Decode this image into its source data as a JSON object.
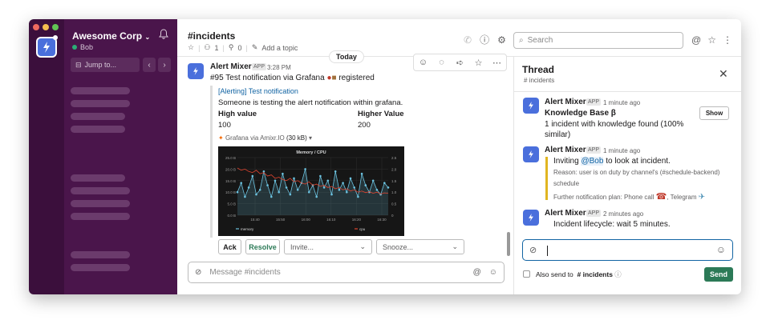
{
  "workspace": {
    "name": "Awesome Corp",
    "user": "Bob",
    "jump_label": "Jump to..."
  },
  "channel": {
    "title": "#incidents",
    "members": "1",
    "pins": "0",
    "add_topic": "Add a topic"
  },
  "search": {
    "placeholder": "Search"
  },
  "divider": {
    "label": "Today"
  },
  "message": {
    "sender": "Alert Mixer",
    "badge": "APP",
    "time": "3:28 PM",
    "text": "#95 Test notification via Grafana",
    "suffix": "registered",
    "alert_title": "[Alerting] Test notification",
    "alert_desc": "Someone is testing the alert notification within grafana.",
    "high_label": "High value",
    "high_value": "100",
    "higher_label": "Higher Value",
    "higher_value": "200",
    "file_label": "Grafana via Amixr.IO",
    "file_size": "(30 kB)",
    "buttons": {
      "ack": "Ack",
      "resolve": "Resolve",
      "invite": "Invite...",
      "snooze": "Snooze..."
    }
  },
  "composer": {
    "placeholder": "Message #incidents"
  },
  "thread": {
    "title": "Thread",
    "channel": "# incidents",
    "show_label": "Show",
    "messages": [
      {
        "sender": "Alert Mixer",
        "badge": "APP",
        "time": "1 minute ago",
        "line1": "Knowledge Base β",
        "line2": "1 incident with knowledge found (100%",
        "line3": "similar)"
      },
      {
        "sender": "Alert Mixer",
        "badge": "APP",
        "time": "1 minute ago",
        "invite_prefix": "Inviting",
        "invite_user": "@Bob",
        "invite_suffix": "to look at incident.",
        "reason": "Reason: user is on duty by channel's (#schedule-backend)",
        "reason2": "schedule",
        "plan": "Further notification plan: Phone call",
        "plan2": ", Telegram"
      },
      {
        "sender": "Alert Mixer",
        "badge": "APP",
        "time": "2 minutes ago",
        "text": "Incident lifecycle: wait 5 minutes."
      }
    ],
    "also_send": "Also send to",
    "also_channel": "# incidents",
    "send_label": "Send"
  },
  "chart_data": {
    "type": "line",
    "title": "Memory / CPU",
    "x": [
      "15:40",
      "15:50",
      "16:00",
      "16:10",
      "16:20",
      "16:30"
    ],
    "y_left_ticks": [
      "0.0 B",
      "5.0 B",
      "10.0 B",
      "15.0 B",
      "20.0 B",
      "25.0 B"
    ],
    "y_right_ticks": [
      "0",
      "0.5",
      "1.0",
      "1.5",
      "2.0",
      "2.5"
    ],
    "ylim_left": [
      0,
      25
    ],
    "ylim_right": [
      0,
      2.5
    ],
    "series": [
      {
        "name": "memory",
        "color": "#6cc3e0",
        "axis": "left",
        "values": [
          10,
          14,
          8,
          12,
          17,
          9,
          11,
          19,
          13,
          8,
          15,
          10,
          18,
          12,
          9,
          16,
          11,
          14,
          20,
          10,
          13,
          8,
          17,
          12,
          15,
          9,
          19,
          11,
          14,
          10,
          16,
          12,
          8,
          18,
          13,
          10,
          15,
          11,
          9,
          14,
          12
        ]
      },
      {
        "name": "cpu",
        "color": "#e0442f",
        "axis": "right",
        "values": [
          2.05,
          1.95,
          2.0,
          1.9,
          1.85,
          1.95,
          1.8,
          1.85,
          1.7,
          1.75,
          1.6,
          1.65,
          1.55,
          1.5,
          1.6,
          1.45,
          1.5,
          1.4,
          1.35,
          1.45,
          1.3,
          1.35,
          1.25,
          1.3,
          1.2,
          1.25,
          1.15,
          1.2,
          1.1,
          1.15,
          1.05,
          1.1,
          1.0,
          1.05,
          0.98,
          1.02,
          0.95,
          1.0,
          0.92,
          0.97,
          0.95
        ]
      }
    ],
    "grid": true,
    "legend": "bottom"
  }
}
